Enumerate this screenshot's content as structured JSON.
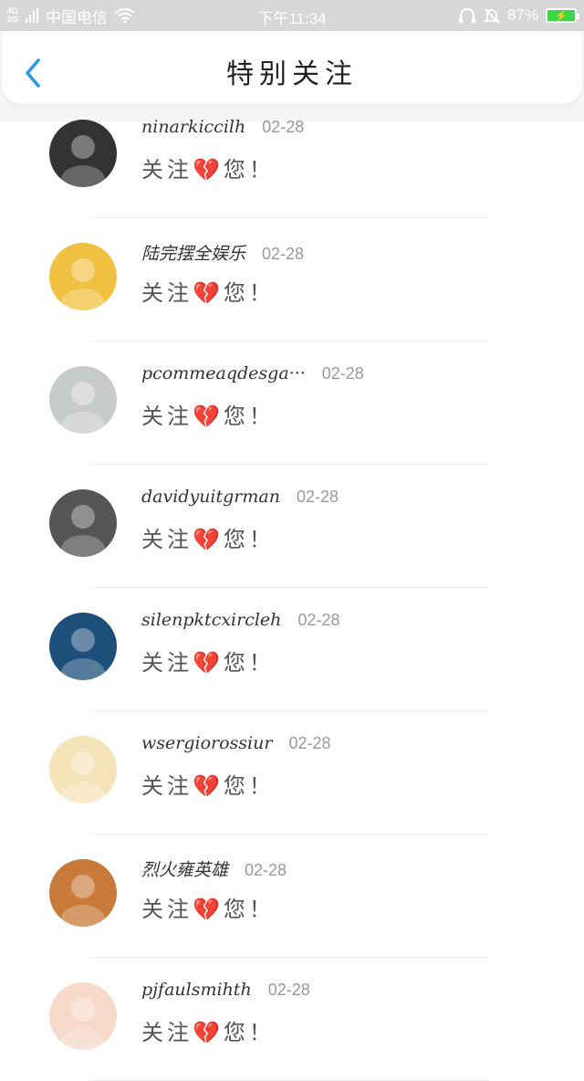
{
  "status_bar": {
    "signal_top": "4G",
    "signal_bottom": "2G",
    "carrier": "中国电信",
    "time": "下午11:34",
    "battery": "87%"
  },
  "header": {
    "title": "特别关注",
    "back_icon": "chevron-left-icon"
  },
  "items": [
    {
      "name": "ninarkiccilh",
      "date": "02-28",
      "message": "关注💔您！",
      "avatar_color": "#333333"
    },
    {
      "name": "陆完摆全娱乐",
      "date": "02-28",
      "message": "关注💔您！",
      "avatar_color": "#f0c040"
    },
    {
      "name": "pcommeaqdesga···",
      "date": "02-28",
      "message": "关注💔您！",
      "avatar_color": "#c8ccc8"
    },
    {
      "name": "davidyuitgrman",
      "date": "02-28",
      "message": "关注💔您！",
      "avatar_color": "#555555"
    },
    {
      "name": "silenpktcxircleh",
      "date": "02-28",
      "message": "关注💔您！",
      "avatar_color": "#1d4f7a"
    },
    {
      "name": "wsergiorossiur",
      "date": "02-28",
      "message": "关注💔您！",
      "avatar_color": "#f4e2b8"
    },
    {
      "name": "烈火雍英雄",
      "date": "02-28",
      "message": "关注💔您！",
      "avatar_color": "#c87a3a"
    },
    {
      "name": "pjfaulsmihth",
      "date": "02-28",
      "message": "关注💔您！",
      "avatar_color": "#f6d9c8"
    }
  ]
}
